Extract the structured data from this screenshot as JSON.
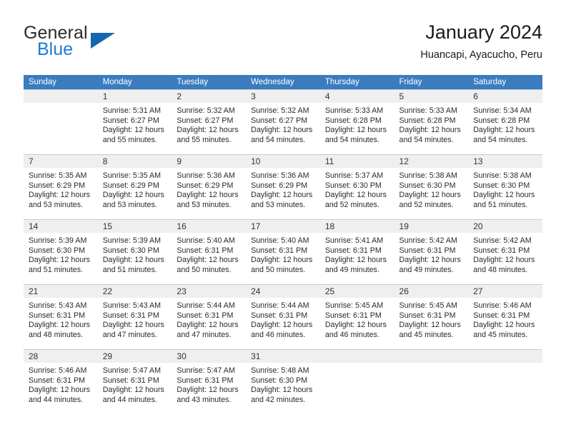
{
  "brand": {
    "name_part1": "General",
    "name_part2": "Blue",
    "triangle_color": "#1567b2",
    "blue_color": "#1c7cd6"
  },
  "header": {
    "title": "January 2024",
    "location": "Huancapi, Ayacucho, Peru"
  },
  "theme": {
    "header_bar_color": "#3a7cbe",
    "daynum_band_color": "#efefef",
    "row_divider_color": "#b8cfe4"
  },
  "calendar": {
    "weekday_headers": [
      "Sunday",
      "Monday",
      "Tuesday",
      "Wednesday",
      "Thursday",
      "Friday",
      "Saturday"
    ],
    "labels": {
      "sunrise_prefix": "Sunrise:",
      "sunset_prefix": "Sunset:",
      "daylight_prefix": "Daylight:"
    },
    "weeks": [
      [
        {
          "day": "",
          "empty": true
        },
        {
          "day": "1",
          "sunrise": "Sunrise: 5:31 AM",
          "sunset": "Sunset: 6:27 PM",
          "daylight_1": "Daylight: 12 hours",
          "daylight_2": "and 55 minutes."
        },
        {
          "day": "2",
          "sunrise": "Sunrise: 5:32 AM",
          "sunset": "Sunset: 6:27 PM",
          "daylight_1": "Daylight: 12 hours",
          "daylight_2": "and 55 minutes."
        },
        {
          "day": "3",
          "sunrise": "Sunrise: 5:32 AM",
          "sunset": "Sunset: 6:27 PM",
          "daylight_1": "Daylight: 12 hours",
          "daylight_2": "and 54 minutes."
        },
        {
          "day": "4",
          "sunrise": "Sunrise: 5:33 AM",
          "sunset": "Sunset: 6:28 PM",
          "daylight_1": "Daylight: 12 hours",
          "daylight_2": "and 54 minutes."
        },
        {
          "day": "5",
          "sunrise": "Sunrise: 5:33 AM",
          "sunset": "Sunset: 6:28 PM",
          "daylight_1": "Daylight: 12 hours",
          "daylight_2": "and 54 minutes."
        },
        {
          "day": "6",
          "sunrise": "Sunrise: 5:34 AM",
          "sunset": "Sunset: 6:28 PM",
          "daylight_1": "Daylight: 12 hours",
          "daylight_2": "and 54 minutes."
        }
      ],
      [
        {
          "day": "7",
          "sunrise": "Sunrise: 5:35 AM",
          "sunset": "Sunset: 6:29 PM",
          "daylight_1": "Daylight: 12 hours",
          "daylight_2": "and 53 minutes."
        },
        {
          "day": "8",
          "sunrise": "Sunrise: 5:35 AM",
          "sunset": "Sunset: 6:29 PM",
          "daylight_1": "Daylight: 12 hours",
          "daylight_2": "and 53 minutes."
        },
        {
          "day": "9",
          "sunrise": "Sunrise: 5:36 AM",
          "sunset": "Sunset: 6:29 PM",
          "daylight_1": "Daylight: 12 hours",
          "daylight_2": "and 53 minutes."
        },
        {
          "day": "10",
          "sunrise": "Sunrise: 5:36 AM",
          "sunset": "Sunset: 6:29 PM",
          "daylight_1": "Daylight: 12 hours",
          "daylight_2": "and 53 minutes."
        },
        {
          "day": "11",
          "sunrise": "Sunrise: 5:37 AM",
          "sunset": "Sunset: 6:30 PM",
          "daylight_1": "Daylight: 12 hours",
          "daylight_2": "and 52 minutes."
        },
        {
          "day": "12",
          "sunrise": "Sunrise: 5:38 AM",
          "sunset": "Sunset: 6:30 PM",
          "daylight_1": "Daylight: 12 hours",
          "daylight_2": "and 52 minutes."
        },
        {
          "day": "13",
          "sunrise": "Sunrise: 5:38 AM",
          "sunset": "Sunset: 6:30 PM",
          "daylight_1": "Daylight: 12 hours",
          "daylight_2": "and 51 minutes."
        }
      ],
      [
        {
          "day": "14",
          "sunrise": "Sunrise: 5:39 AM",
          "sunset": "Sunset: 6:30 PM",
          "daylight_1": "Daylight: 12 hours",
          "daylight_2": "and 51 minutes."
        },
        {
          "day": "15",
          "sunrise": "Sunrise: 5:39 AM",
          "sunset": "Sunset: 6:30 PM",
          "daylight_1": "Daylight: 12 hours",
          "daylight_2": "and 51 minutes."
        },
        {
          "day": "16",
          "sunrise": "Sunrise: 5:40 AM",
          "sunset": "Sunset: 6:31 PM",
          "daylight_1": "Daylight: 12 hours",
          "daylight_2": "and 50 minutes."
        },
        {
          "day": "17",
          "sunrise": "Sunrise: 5:40 AM",
          "sunset": "Sunset: 6:31 PM",
          "daylight_1": "Daylight: 12 hours",
          "daylight_2": "and 50 minutes."
        },
        {
          "day": "18",
          "sunrise": "Sunrise: 5:41 AM",
          "sunset": "Sunset: 6:31 PM",
          "daylight_1": "Daylight: 12 hours",
          "daylight_2": "and 49 minutes."
        },
        {
          "day": "19",
          "sunrise": "Sunrise: 5:42 AM",
          "sunset": "Sunset: 6:31 PM",
          "daylight_1": "Daylight: 12 hours",
          "daylight_2": "and 49 minutes."
        },
        {
          "day": "20",
          "sunrise": "Sunrise: 5:42 AM",
          "sunset": "Sunset: 6:31 PM",
          "daylight_1": "Daylight: 12 hours",
          "daylight_2": "and 48 minutes."
        }
      ],
      [
        {
          "day": "21",
          "sunrise": "Sunrise: 5:43 AM",
          "sunset": "Sunset: 6:31 PM",
          "daylight_1": "Daylight: 12 hours",
          "daylight_2": "and 48 minutes."
        },
        {
          "day": "22",
          "sunrise": "Sunrise: 5:43 AM",
          "sunset": "Sunset: 6:31 PM",
          "daylight_1": "Daylight: 12 hours",
          "daylight_2": "and 47 minutes."
        },
        {
          "day": "23",
          "sunrise": "Sunrise: 5:44 AM",
          "sunset": "Sunset: 6:31 PM",
          "daylight_1": "Daylight: 12 hours",
          "daylight_2": "and 47 minutes."
        },
        {
          "day": "24",
          "sunrise": "Sunrise: 5:44 AM",
          "sunset": "Sunset: 6:31 PM",
          "daylight_1": "Daylight: 12 hours",
          "daylight_2": "and 46 minutes."
        },
        {
          "day": "25",
          "sunrise": "Sunrise: 5:45 AM",
          "sunset": "Sunset: 6:31 PM",
          "daylight_1": "Daylight: 12 hours",
          "daylight_2": "and 46 minutes."
        },
        {
          "day": "26",
          "sunrise": "Sunrise: 5:45 AM",
          "sunset": "Sunset: 6:31 PM",
          "daylight_1": "Daylight: 12 hours",
          "daylight_2": "and 45 minutes."
        },
        {
          "day": "27",
          "sunrise": "Sunrise: 5:46 AM",
          "sunset": "Sunset: 6:31 PM",
          "daylight_1": "Daylight: 12 hours",
          "daylight_2": "and 45 minutes."
        }
      ],
      [
        {
          "day": "28",
          "sunrise": "Sunrise: 5:46 AM",
          "sunset": "Sunset: 6:31 PM",
          "daylight_1": "Daylight: 12 hours",
          "daylight_2": "and 44 minutes."
        },
        {
          "day": "29",
          "sunrise": "Sunrise: 5:47 AM",
          "sunset": "Sunset: 6:31 PM",
          "daylight_1": "Daylight: 12 hours",
          "daylight_2": "and 44 minutes."
        },
        {
          "day": "30",
          "sunrise": "Sunrise: 5:47 AM",
          "sunset": "Sunset: 6:31 PM",
          "daylight_1": "Daylight: 12 hours",
          "daylight_2": "and 43 minutes."
        },
        {
          "day": "31",
          "sunrise": "Sunrise: 5:48 AM",
          "sunset": "Sunset: 6:30 PM",
          "daylight_1": "Daylight: 12 hours",
          "daylight_2": "and 42 minutes."
        },
        {
          "day": "",
          "empty": true
        },
        {
          "day": "",
          "empty": true
        },
        {
          "day": "",
          "empty": true
        }
      ]
    ]
  }
}
